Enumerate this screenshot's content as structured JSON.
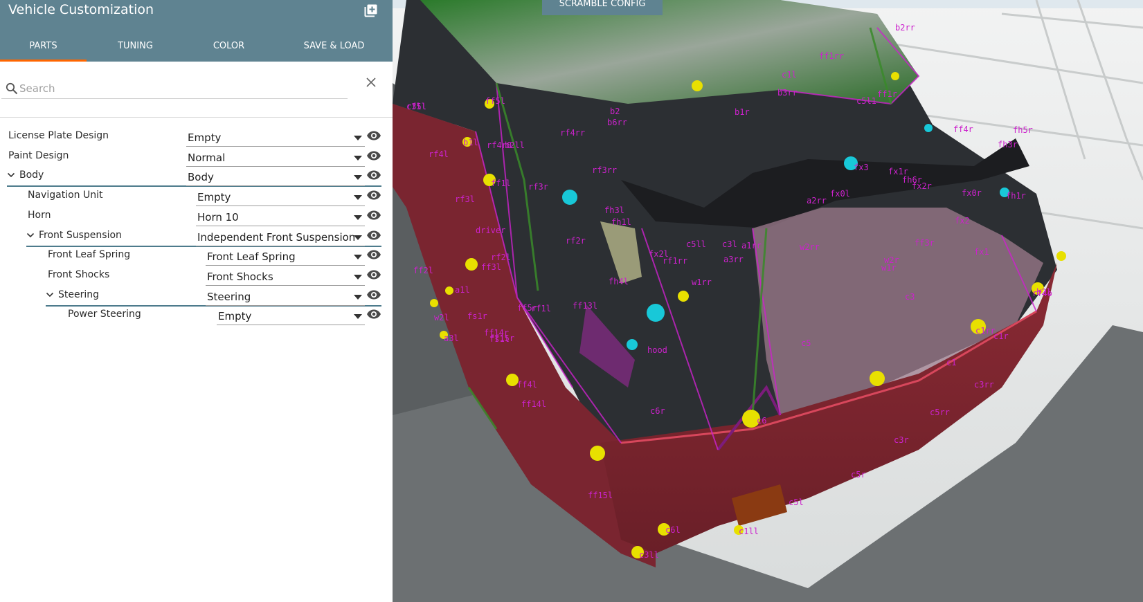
{
  "window": {
    "title": "Vehicle Customization",
    "add_icon": "add-box-icon"
  },
  "tabs": [
    {
      "label": "PARTS",
      "active": true
    },
    {
      "label": "TUNING",
      "active": false
    },
    {
      "label": "COLOR",
      "active": false
    },
    {
      "label": "SAVE & LOAD",
      "active": false
    }
  ],
  "search": {
    "placeholder": "Search",
    "value": ""
  },
  "parts": [
    {
      "label": "License Plate Design",
      "value": "Empty",
      "depth": 0,
      "expandable": false
    },
    {
      "label": "Paint Design",
      "value": "Normal",
      "depth": 0,
      "expandable": false
    },
    {
      "label": "Body",
      "value": "Body",
      "depth": 0,
      "expandable": true
    },
    {
      "label": "Navigation Unit",
      "value": "Empty",
      "depth": 1,
      "expandable": false
    },
    {
      "label": "Horn",
      "value": "Horn 10",
      "depth": 1,
      "expandable": false
    },
    {
      "label": "Front Suspension",
      "value": "Independent Front Suspension",
      "depth": 1,
      "expandable": true
    },
    {
      "label": "Front Leaf Spring",
      "value": "Front Leaf Spring",
      "depth": 2,
      "expandable": false
    },
    {
      "label": "Front Shocks",
      "value": "Front Shocks",
      "depth": 2,
      "expandable": false
    },
    {
      "label": "Steering",
      "value": "Steering",
      "depth": 2,
      "expandable": true
    },
    {
      "label": "Power Steering",
      "value": "Empty",
      "depth": 3,
      "expandable": false
    }
  ],
  "viewport": {
    "scramble_button": "SCRAMBLE CONFIG",
    "node_labels": [
      "rf5l",
      "rf4rr",
      "rf3rr",
      "rf4l",
      "rf3r",
      "rf3l",
      "rf2r",
      "rf2l",
      "rf1l",
      "driver",
      "fh3l",
      "fh4l",
      "ff1l",
      "ff3l",
      "ff4l",
      "ff14l",
      "ff15l",
      "ff5l",
      "fx0r",
      "fx0l",
      "fx3",
      "fx2",
      "fx1",
      "fx2r",
      "fx1r",
      "ff3r",
      "ff4r",
      "fh3r",
      "fh1r",
      "fh5r",
      "fh6r",
      "b1r",
      "b2",
      "b6rr",
      "b7rr",
      "b2l",
      "c1rr",
      "c1r",
      "c1",
      "c3rr",
      "c5rr",
      "c3r",
      "c5r",
      "c3",
      "c5",
      "c6r",
      "c6",
      "c6l",
      "c1ll",
      "c3ll",
      "c5l",
      "c5ll",
      "c3l",
      "a3rr",
      "a2rr",
      "a1rr",
      "w1rr",
      "w2rr",
      "w2r",
      "w1r",
      "hood",
      "fs1r",
      "ff14r",
      "ff15r",
      "ff5r",
      "a1l",
      "a3l",
      "w2l",
      "ff13l",
      "fh1l",
      "fx2l",
      "rf1rr",
      "fs1l",
      "ff2l",
      "b1l",
      "b2ll",
      "rf4r0",
      "rf4o",
      "c1l",
      "c5l1",
      "ff1rr",
      "ff1r",
      "b2rr",
      "b3rr",
      "c3ll"
    ],
    "colors": {
      "header": "#5f8391",
      "accent": "#ff6600",
      "node_label": "#cc22cc",
      "node_yellow": "#e8e000",
      "node_cyan": "#18c8d8"
    }
  }
}
